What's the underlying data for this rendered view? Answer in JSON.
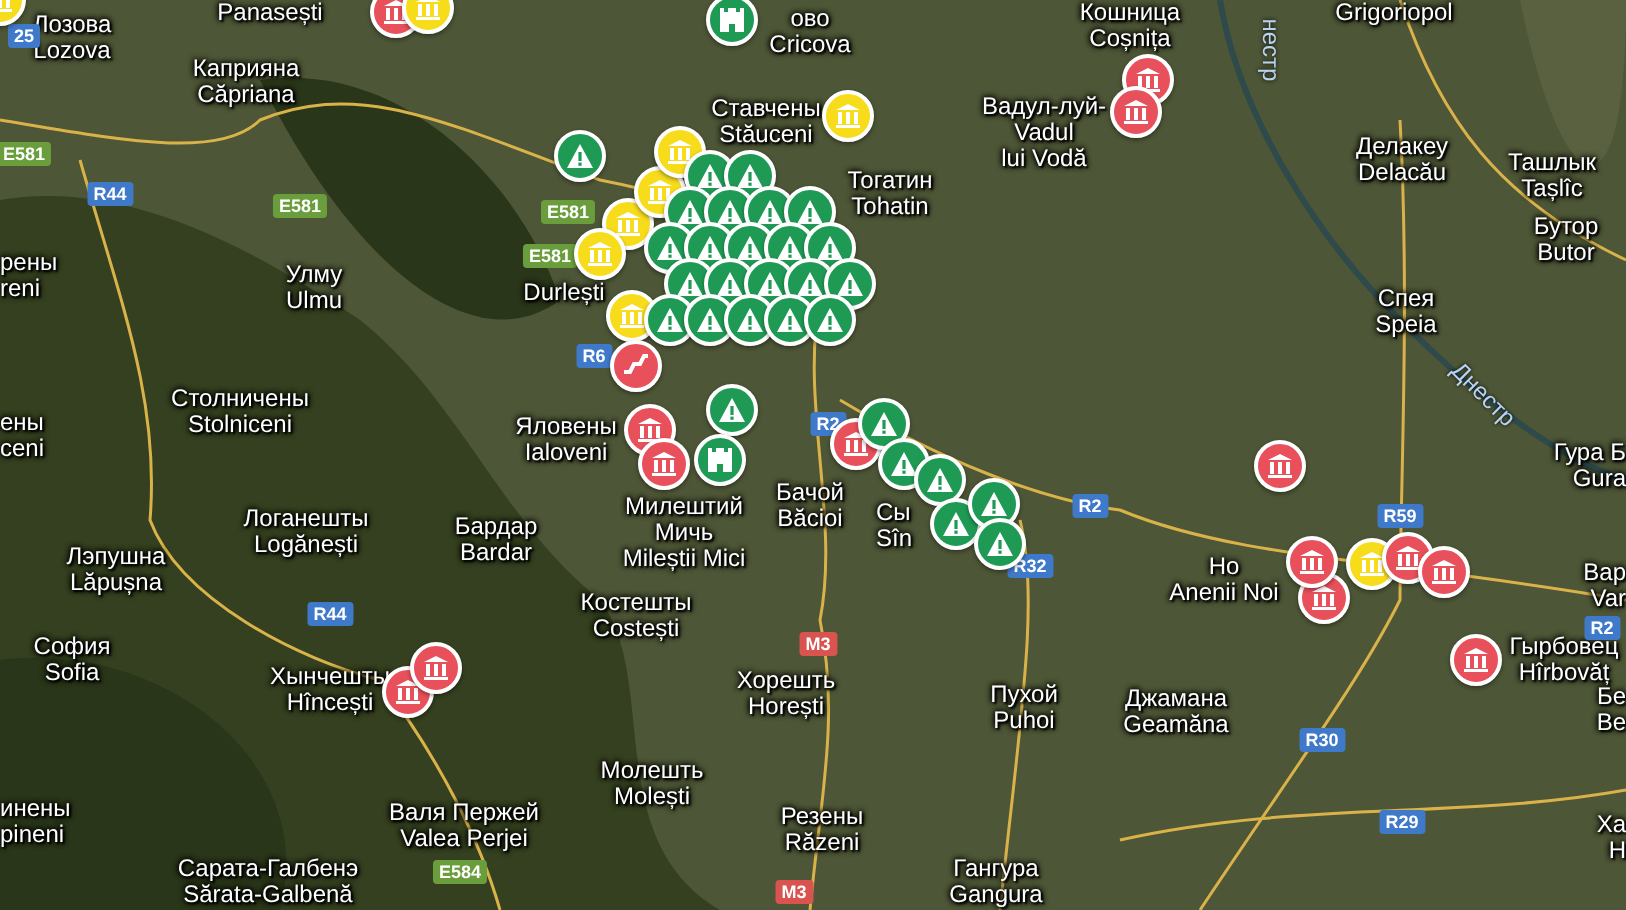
{
  "map": {
    "places": [
      {
        "lines": [
          "Лозова",
          "Lozova"
        ]
      },
      {
        "lines": [
          "Panasești"
        ]
      },
      {
        "lines": [
          "Каприяна",
          "Căpriana"
        ]
      },
      {
        "lines": [
          "ово",
          "Cricova"
        ]
      },
      {
        "lines": [
          "Кошница",
          "Coșnița"
        ]
      },
      {
        "lines": [
          "Grigoriopol"
        ]
      },
      {
        "lines": [
          "Ставчены",
          "Stăuceni"
        ]
      },
      {
        "lines": [
          "Тогатин",
          "Tohatin"
        ]
      },
      {
        "lines": [
          "Вадул-луй-",
          "Vadul",
          "lui Vodă"
        ]
      },
      {
        "lines": [
          "Делакеу",
          "Delacău"
        ]
      },
      {
        "lines": [
          "Ташлык",
          "Tașlîc"
        ]
      },
      {
        "lines": [
          "рены",
          "reni"
        ]
      },
      {
        "lines": [
          "Улму",
          "Ulmu"
        ]
      },
      {
        "lines": [
          "Durlești"
        ]
      },
      {
        "lines": [
          "Бутор",
          "Butor"
        ]
      },
      {
        "lines": [
          "Спея",
          "Speia"
        ]
      },
      {
        "lines": [
          "ены",
          "ceni"
        ]
      },
      {
        "lines": [
          "Столничены",
          "Stolniceni"
        ]
      },
      {
        "lines": [
          "Яловены",
          "Ialoveni"
        ]
      },
      {
        "lines": [
          "Лэпушна",
          "Lăpușna"
        ]
      },
      {
        "lines": [
          "Логанешты",
          "Logănești"
        ]
      },
      {
        "lines": [
          "Бардар",
          "Bardar"
        ]
      },
      {
        "lines": [
          "Милештий",
          "Мичь",
          "Mileștii Mici"
        ]
      },
      {
        "lines": [
          "Бачой",
          "Băcioi"
        ]
      },
      {
        "lines": [
          "Сы",
          "Sîn"
        ]
      },
      {
        "lines": [
          "Гура Б",
          "Gura"
        ]
      },
      {
        "lines": [
          "София",
          "Sofia"
        ]
      },
      {
        "lines": [
          "Костешты",
          "Costești"
        ]
      },
      {
        "lines": [
          "Но",
          "Anenii Noi"
        ]
      },
      {
        "lines": [
          "Вар",
          "Var"
        ]
      },
      {
        "lines": [
          "Хынчешты",
          "Hîncești"
        ]
      },
      {
        "lines": [
          "Хорешть",
          "Horești"
        ]
      },
      {
        "lines": [
          "Пухой",
          "Puhoi"
        ]
      },
      {
        "lines": [
          "Джамана",
          "Geamăna"
        ]
      },
      {
        "lines": [
          "Гырбовец",
          "Hîrbovăț"
        ]
      },
      {
        "lines": [
          "Бе",
          "Be"
        ]
      },
      {
        "lines": [
          "инены",
          "pineni"
        ]
      },
      {
        "lines": [
          "Валя Пержей",
          "Valea Perjei"
        ]
      },
      {
        "lines": [
          "Молешть",
          "Molești"
        ]
      },
      {
        "lines": [
          "Резены",
          "Răzeni"
        ]
      },
      {
        "lines": [
          "Сарата-Галбенэ",
          "Sărata-Galbenă"
        ]
      },
      {
        "lines": [
          "Гангура",
          "Gangura"
        ]
      },
      {
        "lines": [
          "Ха",
          "H"
        ]
      }
    ],
    "river_labels": [
      {
        "text": "нестр"
      },
      {
        "text": "Днестр"
      }
    ],
    "road_shields": [
      {
        "text": "25",
        "kind": "national"
      },
      {
        "text": "E581",
        "kind": "european"
      },
      {
        "text": "R44",
        "kind": "national"
      },
      {
        "text": "E581",
        "kind": "european"
      },
      {
        "text": "E581",
        "kind": "european"
      },
      {
        "text": "E581",
        "kind": "european"
      },
      {
        "text": "R6",
        "kind": "national"
      },
      {
        "text": "R2",
        "kind": "national"
      },
      {
        "text": "R2",
        "kind": "national"
      },
      {
        "text": "R32",
        "kind": "national"
      },
      {
        "text": "M3",
        "kind": "motorway"
      },
      {
        "text": "M3",
        "kind": "motorway"
      },
      {
        "text": "R44",
        "kind": "national"
      },
      {
        "text": "E584",
        "kind": "european"
      },
      {
        "text": "R59",
        "kind": "national"
      },
      {
        "text": "R30",
        "kind": "national"
      },
      {
        "text": "R29",
        "kind": "national"
      },
      {
        "text": "R2",
        "kind": "national"
      }
    ],
    "pins": [
      {
        "kind": "monument",
        "color": "#e8505b"
      },
      {
        "kind": "monument",
        "color": "#f7dc1b"
      },
      {
        "kind": "fortress",
        "color": "#1f9a55"
      },
      {
        "kind": "monument",
        "color": "#f7dc1b"
      },
      {
        "kind": "warning",
        "color": "#1f9a55"
      },
      {
        "kind": "monument",
        "color": "#f7dc1b"
      },
      {
        "kind": "monument",
        "color": "#f7dc1b"
      },
      {
        "kind": "monument",
        "color": "#f7dc1b"
      },
      {
        "kind": "monument",
        "color": "#e8505b"
      },
      {
        "kind": "monument",
        "color": "#e8505b"
      },
      {
        "kind": "monument",
        "color": "#f7dc1b"
      },
      {
        "kind": "monument",
        "color": "#f7dc1b"
      },
      {
        "kind": "warning",
        "color": "#1f9a55"
      },
      {
        "kind": "warning",
        "color": "#1f9a55"
      },
      {
        "kind": "warning",
        "color": "#1f9a55"
      },
      {
        "kind": "warning",
        "color": "#1f9a55"
      },
      {
        "kind": "warning",
        "color": "#1f9a55"
      },
      {
        "kind": "warning",
        "color": "#1f9a55"
      },
      {
        "kind": "warning",
        "color": "#1f9a55"
      },
      {
        "kind": "warning",
        "color": "#1f9a55"
      },
      {
        "kind": "warning",
        "color": "#1f9a55"
      },
      {
        "kind": "warning",
        "color": "#1f9a55"
      },
      {
        "kind": "warning",
        "color": "#1f9a55"
      },
      {
        "kind": "warning",
        "color": "#1f9a55"
      },
      {
        "kind": "warning",
        "color": "#1f9a55"
      },
      {
        "kind": "warning",
        "color": "#1f9a55"
      },
      {
        "kind": "warning",
        "color": "#1f9a55"
      },
      {
        "kind": "warning",
        "color": "#1f9a55"
      },
      {
        "kind": "warning",
        "color": "#1f9a55"
      },
      {
        "kind": "warning",
        "color": "#1f9a55"
      },
      {
        "kind": "warning",
        "color": "#1f9a55"
      },
      {
        "kind": "warning",
        "color": "#1f9a55"
      },
      {
        "kind": "warning",
        "color": "#1f9a55"
      },
      {
        "kind": "stairs",
        "color": "#e8505b"
      },
      {
        "kind": "monument",
        "color": "#e8505b"
      },
      {
        "kind": "monument",
        "color": "#e8505b"
      },
      {
        "kind": "warning",
        "color": "#1f9a55"
      },
      {
        "kind": "fortress",
        "color": "#1f9a55"
      },
      {
        "kind": "monument",
        "color": "#e8505b"
      },
      {
        "kind": "warning",
        "color": "#1f9a55"
      },
      {
        "kind": "warning",
        "color": "#1f9a55"
      },
      {
        "kind": "warning",
        "color": "#1f9a55"
      },
      {
        "kind": "warning",
        "color": "#1f9a55"
      },
      {
        "kind": "warning",
        "color": "#1f9a55"
      },
      {
        "kind": "warning",
        "color": "#1f9a55"
      },
      {
        "kind": "monument",
        "color": "#e8505b"
      },
      {
        "kind": "monument",
        "color": "#e8505b"
      },
      {
        "kind": "monument",
        "color": "#e8505b"
      },
      {
        "kind": "monument",
        "color": "#f7dc1b"
      },
      {
        "kind": "monument",
        "color": "#e8505b"
      },
      {
        "kind": "monument",
        "color": "#e8505b"
      },
      {
        "kind": "monument",
        "color": "#e8505b"
      },
      {
        "kind": "monument",
        "color": "#e8505b"
      },
      {
        "kind": "monument",
        "color": "#e8505b"
      },
      {
        "kind": "monument",
        "color": "#f7dc1b"
      }
    ]
  }
}
